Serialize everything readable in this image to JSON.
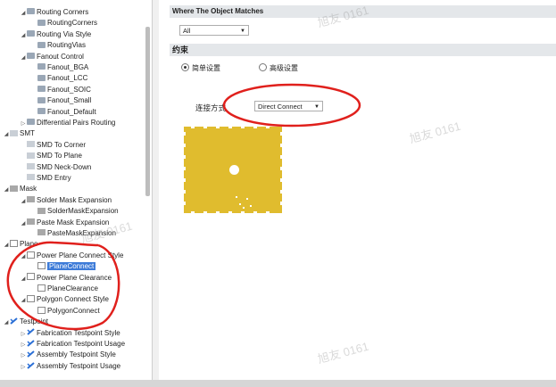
{
  "tree": {
    "items": [
      {
        "label": "Routing Corners",
        "indent": 1,
        "arrow": "◢",
        "icon": "route"
      },
      {
        "label": "RoutingCorners",
        "indent": 2,
        "arrow": "",
        "icon": "route"
      },
      {
        "label": "Routing Via Style",
        "indent": 1,
        "arrow": "◢",
        "icon": "route"
      },
      {
        "label": "RoutingVias",
        "indent": 2,
        "arrow": "",
        "icon": "route"
      },
      {
        "label": "Fanout Control",
        "indent": 1,
        "arrow": "◢",
        "icon": "route"
      },
      {
        "label": "Fanout_BGA",
        "indent": 2,
        "arrow": "",
        "icon": "route"
      },
      {
        "label": "Fanout_LCC",
        "indent": 2,
        "arrow": "",
        "icon": "route"
      },
      {
        "label": "Fanout_SOIC",
        "indent": 2,
        "arrow": "",
        "icon": "route"
      },
      {
        "label": "Fanout_Small",
        "indent": 2,
        "arrow": "",
        "icon": "route"
      },
      {
        "label": "Fanout_Default",
        "indent": 2,
        "arrow": "",
        "icon": "route"
      },
      {
        "label": "Differential Pairs Routing",
        "indent": 1,
        "arrow": "▷",
        "icon": "route"
      },
      {
        "label": "SMT",
        "indent": 0,
        "arrow": "◢",
        "icon": "smd"
      },
      {
        "label": "SMD To Corner",
        "indent": 1,
        "arrow": "",
        "icon": "smd"
      },
      {
        "label": "SMD To Plane",
        "indent": 1,
        "arrow": "",
        "icon": "smd"
      },
      {
        "label": "SMD Neck-Down",
        "indent": 1,
        "arrow": "",
        "icon": "smd"
      },
      {
        "label": "SMD Entry",
        "indent": 1,
        "arrow": "",
        "icon": "smd"
      },
      {
        "label": "Mask",
        "indent": 0,
        "arrow": "◢",
        "icon": "mask"
      },
      {
        "label": "Solder Mask Expansion",
        "indent": 1,
        "arrow": "◢",
        "icon": "mask"
      },
      {
        "label": "SolderMaskExpansion",
        "indent": 2,
        "arrow": "",
        "icon": "mask"
      },
      {
        "label": "Paste Mask Expansion",
        "indent": 1,
        "arrow": "◢",
        "icon": "mask"
      },
      {
        "label": "PasteMaskExpansion",
        "indent": 2,
        "arrow": "",
        "icon": "mask"
      },
      {
        "label": "Plane",
        "indent": 0,
        "arrow": "◢",
        "icon": "plane"
      },
      {
        "label": "Power Plane Connect Style",
        "indent": 1,
        "arrow": "◢",
        "icon": "plane"
      },
      {
        "label": "PlaneConnect",
        "indent": 2,
        "arrow": "",
        "icon": "plane",
        "selected": true
      },
      {
        "label": "Power Plane Clearance",
        "indent": 1,
        "arrow": "◢",
        "icon": "plane"
      },
      {
        "label": "PlaneClearance",
        "indent": 2,
        "arrow": "",
        "icon": "plane"
      },
      {
        "label": "Polygon Connect Style",
        "indent": 1,
        "arrow": "◢",
        "icon": "plane"
      },
      {
        "label": "PolygonConnect",
        "indent": 2,
        "arrow": "",
        "icon": "plane"
      },
      {
        "label": "Testpoint",
        "indent": 0,
        "arrow": "◢",
        "icon": "test"
      },
      {
        "label": "Fabrication Testpoint Style",
        "indent": 1,
        "arrow": "▷",
        "icon": "test"
      },
      {
        "label": "Fabrication Testpoint Usage",
        "indent": 1,
        "arrow": "▷",
        "icon": "test"
      },
      {
        "label": "Assembly Testpoint Style",
        "indent": 1,
        "arrow": "▷",
        "icon": "test"
      },
      {
        "label": "Assembly Testpoint Usage",
        "indent": 1,
        "arrow": "▷",
        "icon": "test"
      }
    ]
  },
  "match": {
    "header": "Where The Object Matches",
    "select_value": "All"
  },
  "constraints": {
    "header": "约束",
    "radio_simple": "简单设置",
    "radio_advanced": "高级设置",
    "connect_label": "连接方式",
    "connect_value": "Direct Connect"
  },
  "watermark": "旭友 0161",
  "colors": {
    "annotation": "#e0201c",
    "copper": "#e0bc2e",
    "selection": "#3d7bd8"
  }
}
